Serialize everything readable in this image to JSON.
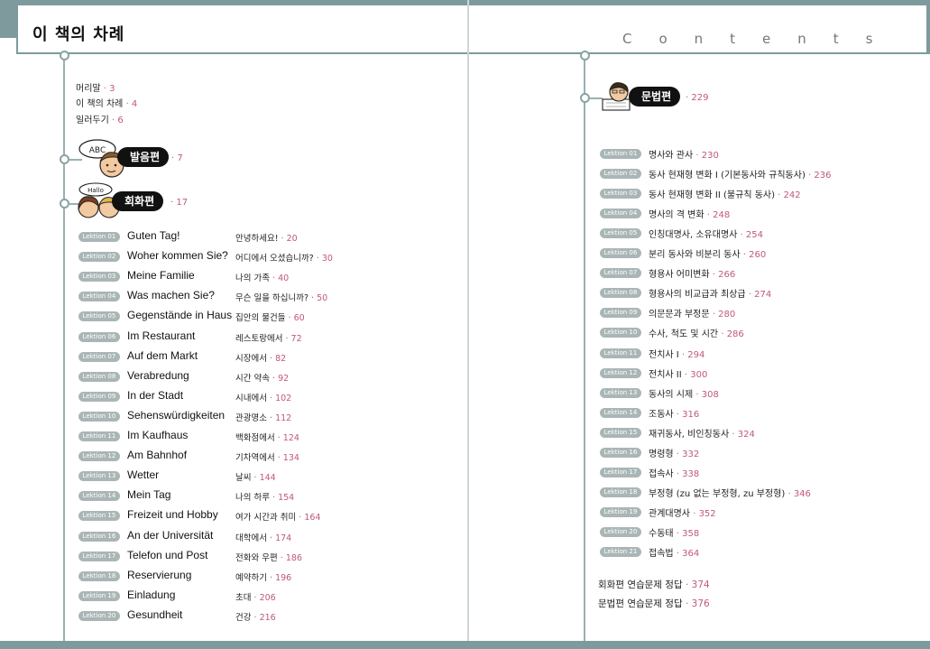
{
  "header": {
    "book_title": "이 책의 차례",
    "contents_word": "Contents"
  },
  "intro": [
    {
      "label": "머리말",
      "page": "3"
    },
    {
      "label": "이 책의 차례",
      "page": "4"
    },
    {
      "label": "일러두기",
      "page": "6"
    }
  ],
  "sections": {
    "pron": {
      "label": "발음편",
      "page": "7",
      "icon_text": "ABC"
    },
    "conv": {
      "label": "회화편",
      "page": "17",
      "icon_text": "Hallo"
    },
    "gram": {
      "label": "문법편",
      "page": "229"
    }
  },
  "sep": "·",
  "conversation": [
    {
      "lek": "Lektion 01",
      "de": "Guten Tag!",
      "ko": "안녕하세요!",
      "page": "20"
    },
    {
      "lek": "Lektion 02",
      "de": "Woher kommen Sie?",
      "ko": "어디에서 오셨습니까?",
      "page": "30"
    },
    {
      "lek": "Lektion 03",
      "de": "Meine Familie",
      "ko": "나의 가족",
      "page": "40"
    },
    {
      "lek": "Lektion 04",
      "de": "Was machen Sie?",
      "ko": "무슨 일을 하십니까?",
      "page": "50"
    },
    {
      "lek": "Lektion 05",
      "de": "Gegenstände in Haus",
      "ko": "집안의 물건들",
      "page": "60"
    },
    {
      "lek": "Lektion 06",
      "de": "Im Restaurant",
      "ko": "레스토랑에서",
      "page": "72"
    },
    {
      "lek": "Lektion 07",
      "de": "Auf dem Markt",
      "ko": "시장에서",
      "page": "82"
    },
    {
      "lek": "Lektion 08",
      "de": "Verabredung",
      "ko": "시간 약속",
      "page": "92"
    },
    {
      "lek": "Lektion 09",
      "de": "In der Stadt",
      "ko": "시내에서",
      "page": "102"
    },
    {
      "lek": "Lektion 10",
      "de": "Sehenswürdigkeiten",
      "ko": "관광명소",
      "page": "112"
    },
    {
      "lek": "Lektion 11",
      "de": "Im Kaufhaus",
      "ko": "백화점에서",
      "page": "124"
    },
    {
      "lek": "Lektion 12",
      "de": "Am Bahnhof",
      "ko": "기차역에서",
      "page": "134"
    },
    {
      "lek": "Lektion 13",
      "de": "Wetter",
      "ko": "날씨",
      "page": "144"
    },
    {
      "lek": "Lektion 14",
      "de": "Mein Tag",
      "ko": "나의 하루",
      "page": "154"
    },
    {
      "lek": "Lektion 15",
      "de": "Freizeit und Hobby",
      "ko": "여가 시간과 취미",
      "page": "164"
    },
    {
      "lek": "Lektion 16",
      "de": "An der Universität",
      "ko": "대학에서",
      "page": "174"
    },
    {
      "lek": "Lektion 17",
      "de": "Telefon und Post",
      "ko": "전화와 우편",
      "page": "186"
    },
    {
      "lek": "Lektion 18",
      "de": "Reservierung",
      "ko": "예약하기",
      "page": "196"
    },
    {
      "lek": "Lektion 19",
      "de": "Einladung",
      "ko": "초대",
      "page": "206"
    },
    {
      "lek": "Lektion 20",
      "de": "Gesundheit",
      "ko": "건강",
      "page": "216"
    }
  ],
  "grammar": [
    {
      "lek": "Lektion 01",
      "ko": "명사와 관사",
      "page": "230"
    },
    {
      "lek": "Lektion 02",
      "ko": "동사 현재형 변화 I (기본동사와 규칙동사)",
      "page": "236"
    },
    {
      "lek": "Lektion 03",
      "ko": "동사 현재형 변화 II (불규칙 동사)",
      "page": "242"
    },
    {
      "lek": "Lektion 04",
      "ko": "명사의 격 변화",
      "page": "248"
    },
    {
      "lek": "Lektion 05",
      "ko": "인칭대명사, 소유대명사",
      "page": "254"
    },
    {
      "lek": "Lektion 06",
      "ko": "분리 동사와 비분리 동사",
      "page": "260"
    },
    {
      "lek": "Lektion 07",
      "ko": "형용사 어미변화",
      "page": "266"
    },
    {
      "lek": "Lektion 08",
      "ko": "형용사의 비교급과 최상급",
      "page": "274"
    },
    {
      "lek": "Lektion 09",
      "ko": "의문문과 부정문",
      "page": "280"
    },
    {
      "lek": "Lektion 10",
      "ko": "수사, 척도 및 시간",
      "page": "286"
    },
    {
      "lek": "Lektion 11",
      "ko": "전치사 I",
      "page": "294"
    },
    {
      "lek": "Lektion 12",
      "ko": "전치사 II",
      "page": "300"
    },
    {
      "lek": "Lektion 13",
      "ko": "동사의 시제",
      "page": "308"
    },
    {
      "lek": "Lektion 14",
      "ko": "조동사",
      "page": "316"
    },
    {
      "lek": "Lektion 15",
      "ko": "재귀동사, 비인칭동사",
      "page": "324"
    },
    {
      "lek": "Lektion 16",
      "ko": "명령형",
      "page": "332"
    },
    {
      "lek": "Lektion 17",
      "ko": "접속사",
      "page": "338"
    },
    {
      "lek": "Lektion 18",
      "ko": "부정형 (zu 없는 부정형, zu 부정형)",
      "page": "346"
    },
    {
      "lek": "Lektion 19",
      "ko": "관계대명사",
      "page": "352"
    },
    {
      "lek": "Lektion 20",
      "ko": "수동태",
      "page": "358"
    },
    {
      "lek": "Lektion 21",
      "ko": "접속법",
      "page": "364"
    }
  ],
  "answers": [
    {
      "label": "회화편 연습문제 정답",
      "page": "374"
    },
    {
      "label": "문법편 연습문제 정답",
      "page": "376"
    }
  ]
}
